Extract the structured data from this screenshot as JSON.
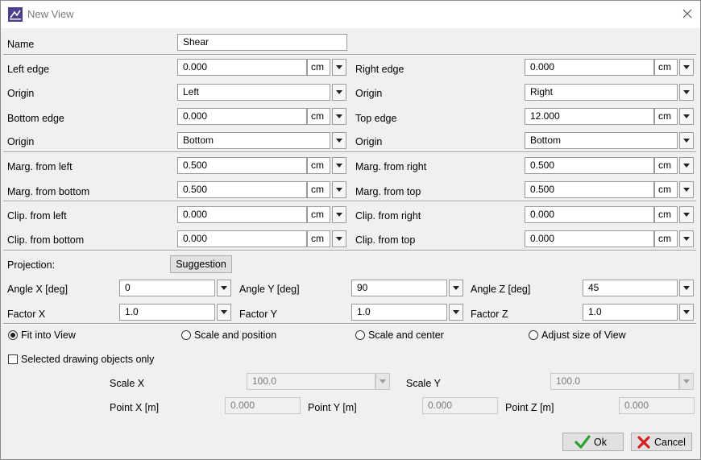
{
  "window": {
    "title": "New View",
    "app_icon": "new-view-app-icon",
    "close_icon": "close-icon"
  },
  "name": {
    "label": "Name",
    "value": "Shear"
  },
  "edges": {
    "left_edge": {
      "label": "Left edge",
      "value": "0.000",
      "unit": "cm"
    },
    "right_edge": {
      "label": "Right edge",
      "value": "0.000",
      "unit": "cm"
    },
    "origin_left": {
      "label": "Origin",
      "value": "Left"
    },
    "origin_right": {
      "label": "Origin",
      "value": "Right"
    },
    "bottom_edge": {
      "label": "Bottom edge",
      "value": "0.000",
      "unit": "cm"
    },
    "top_edge": {
      "label": "Top edge",
      "value": "12.000",
      "unit": "cm"
    },
    "origin_bottom": {
      "label": "Origin",
      "value": "Bottom"
    },
    "origin_top": {
      "label": "Origin",
      "value": "Bottom"
    }
  },
  "margins": {
    "from_left": {
      "label": "Marg. from left",
      "value": "0.500",
      "unit": "cm"
    },
    "from_right": {
      "label": "Marg. from right",
      "value": "0.500",
      "unit": "cm"
    },
    "from_bottom": {
      "label": "Marg. from bottom",
      "value": "0.500",
      "unit": "cm"
    },
    "from_top": {
      "label": "Marg. from top",
      "value": "0.500",
      "unit": "cm"
    }
  },
  "clips": {
    "from_left": {
      "label": "Clip. from left",
      "value": "0.000",
      "unit": "cm"
    },
    "from_right": {
      "label": "Clip. from right",
      "value": "0.000",
      "unit": "cm"
    },
    "from_bottom": {
      "label": "Clip. from bottom",
      "value": "0.000",
      "unit": "cm"
    },
    "from_top": {
      "label": "Clip. from top",
      "value": "0.000",
      "unit": "cm"
    }
  },
  "projection": {
    "label": "Projection:",
    "suggestion_button": "Suggestion",
    "angle_x": {
      "label": "Angle X [deg]",
      "value": "0"
    },
    "angle_y": {
      "label": "Angle Y [deg]",
      "value": "90"
    },
    "angle_z": {
      "label": "Angle Z [deg]",
      "value": "45"
    },
    "factor_x": {
      "label": "Factor X",
      "value": "1.0"
    },
    "factor_y": {
      "label": "Factor Y",
      "value": "1.0"
    },
    "factor_z": {
      "label": "Factor Z",
      "value": "1.0"
    }
  },
  "mode": {
    "selected": "Fit into View",
    "options": [
      "Fit into View",
      "Scale and position",
      "Scale and center",
      "Adjust size of View"
    ]
  },
  "selected_only": {
    "label": "Selected drawing objects only",
    "checked": false
  },
  "scale": {
    "scale_x": {
      "label": "Scale X",
      "value": "100.0"
    },
    "scale_y": {
      "label": "Scale Y",
      "value": "100.0"
    },
    "point_x": {
      "label": "Point X [m]",
      "value": "0.000"
    },
    "point_y": {
      "label": "Point Y [m]",
      "value": "0.000"
    },
    "point_z": {
      "label": "Point Z [m]",
      "value": "0.000"
    }
  },
  "buttons": {
    "ok": "Ok",
    "cancel": "Cancel",
    "ok_icon": "check-icon",
    "cancel_icon": "cross-icon",
    "ok_color": "#2e9e2e",
    "cancel_color": "#d42020"
  }
}
